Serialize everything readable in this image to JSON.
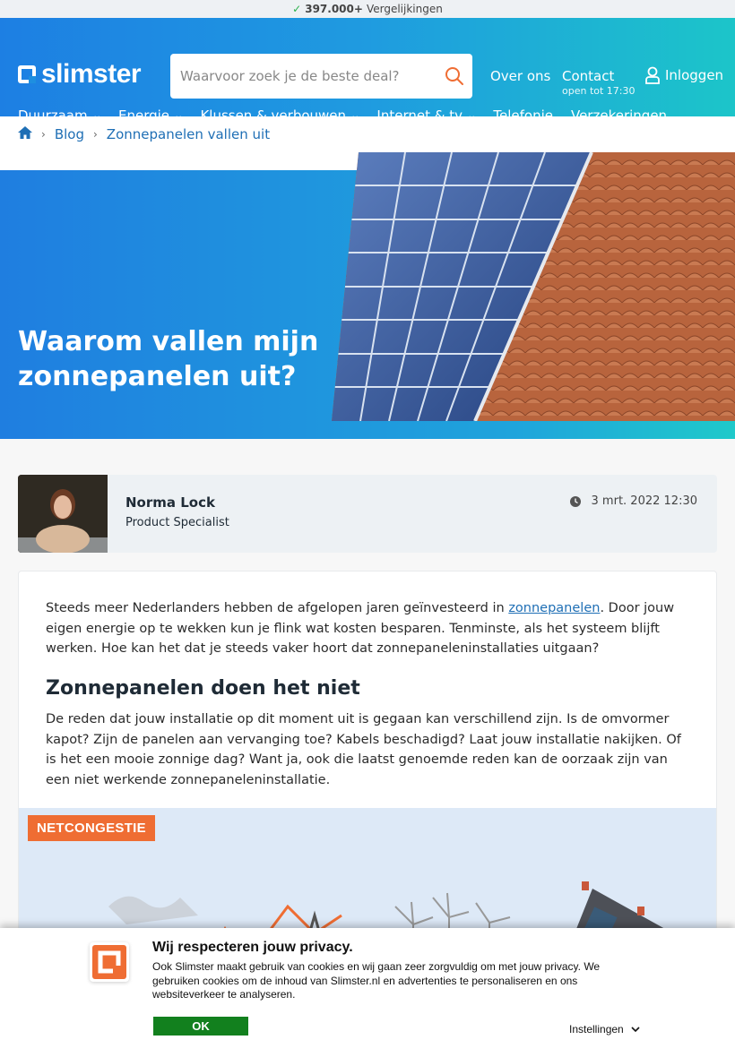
{
  "topbar": {
    "count": "397.000+",
    "label": "Vergelijkingen"
  },
  "header": {
    "logo": "slimster",
    "search_placeholder": "Waarvoor zoek je de beste deal?",
    "over_ons": "Over ons",
    "contact": "Contact",
    "contact_hours": "open tot 17:30",
    "login": "Inloggen"
  },
  "nav": {
    "items": [
      {
        "label": "Duurzaam"
      },
      {
        "label": "Energie"
      },
      {
        "label": "Klussen & verbouwen"
      },
      {
        "label": "Internet & tv"
      },
      {
        "label": "Telefonie"
      },
      {
        "label": "Verzekeringen"
      }
    ]
  },
  "breadcrumb": {
    "blog": "Blog",
    "current": "Zonnepanelen vallen uit"
  },
  "hero": {
    "title": "Waarom vallen mijn zonnepanelen uit?"
  },
  "author": {
    "name": "Norma Lock",
    "role": "Product Specialist",
    "date": "3 mrt. 2022 12:30"
  },
  "article": {
    "p1_before": "Steeds meer Nederlanders hebben de afgelopen jaren geïnvesteerd in ",
    "p1_link": "zonnepanelen",
    "p1_after": ". Door jouw eigen energie op te wekken kun je flink wat kosten besparen. Tenminste, als het systeem blijft werken. Hoe kan het dat je steeds vaker hoort dat zonnepaneleninstallaties uitgaan?",
    "h2": "Zonnepanelen doen het niet",
    "p2": "De reden dat jouw installatie op dit moment uit is gegaan kan verschillend zijn. Is de omvormer kapot? Zijn de panelen aan vervanging toe? Kabels beschadigd? Laat jouw installatie nakijken. Of is het een mooie zonnige dag? Want ja, ook die laatst genoemde reden kan de oorzaak zijn van een niet werkende zonnepaneleninstallatie.",
    "image_tag": "NETCONGESTIE"
  },
  "cookie": {
    "title": "Wij respecteren jouw privacy.",
    "text": "Ook Slimster maakt gebruik van cookies en wij gaan zeer zorgvuldig om met jouw privacy. We gebruiken cookies om de inhoud van Slimster.nl en advertenties te personaliseren en ons websiteverkeer te analyseren.",
    "ok": "OK",
    "settings": "Instellingen"
  },
  "colors": {
    "brand_blue": "#1d7fe3",
    "brand_teal": "#1cc5c9",
    "accent_orange": "#ef6d33",
    "ok_green": "#12801e"
  }
}
